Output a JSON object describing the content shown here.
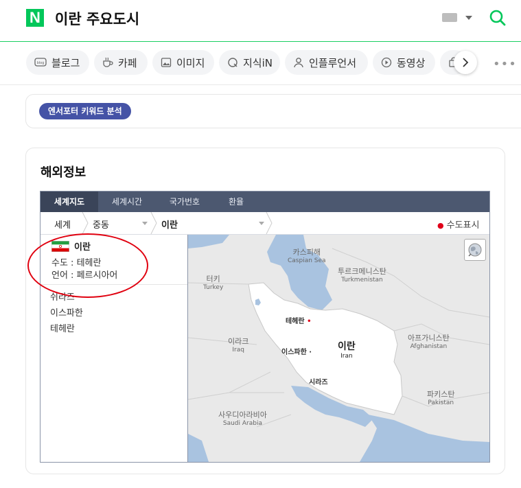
{
  "header": {
    "logo": "N",
    "query": "이란 주요도시"
  },
  "tabs": [
    {
      "label": "블로그"
    },
    {
      "label": "카페"
    },
    {
      "label": "이미지"
    },
    {
      "label": "지식iN"
    },
    {
      "label": "인플루언서"
    },
    {
      "label": "동영상"
    }
  ],
  "influencer": {
    "badge": "엔서포터 키워드 분석"
  },
  "info": {
    "title": "해외정보",
    "widget_tabs": [
      {
        "label": "세계지도",
        "active": true
      },
      {
        "label": "세계시간"
      },
      {
        "label": "국가번호"
      },
      {
        "label": "환율"
      }
    ],
    "breadcrumb": {
      "world": "세계",
      "region": "중동",
      "country": "이란",
      "capital_toggle": "수도표시"
    },
    "country": {
      "name": "이란",
      "capital": "수도 : 테헤란",
      "language": "언어 : 페르시아어"
    },
    "cities": [
      "쉬라즈",
      "이스파한",
      "테헤란"
    ],
    "map_labels": {
      "caspian_ko": "카스피해",
      "caspian_en": "Caspian Sea",
      "turkmenistan_ko": "투르크메니스탄",
      "turkmenistan_en": "Turkmenistan",
      "turkey_ko": "터키",
      "turkey_en": "Turkey",
      "tehran": "테헤란",
      "iraq_ko": "이라크",
      "iraq_en": "Iraq",
      "isfahan": "이스파한",
      "iran_ko": "이란",
      "iran_en": "Iran",
      "afghanistan_ko": "아프가니스탄",
      "afghanistan_en": "Afghanistan",
      "shiraz": "시라즈",
      "pakistan_ko": "파키스탄",
      "pakistan_en": "Pakistan",
      "saudi_ko": "사우디아라비아",
      "saudi_en": "Saudi Arabia"
    }
  },
  "colors": {
    "naver_green": "#03c75a",
    "badge_blue": "#4553a6",
    "widget_tab_bg": "#4c5870",
    "sea": "#a9c3e0",
    "land": "#e9e9e9",
    "highlight": "#ffffff",
    "annotation": "#e0000f"
  }
}
